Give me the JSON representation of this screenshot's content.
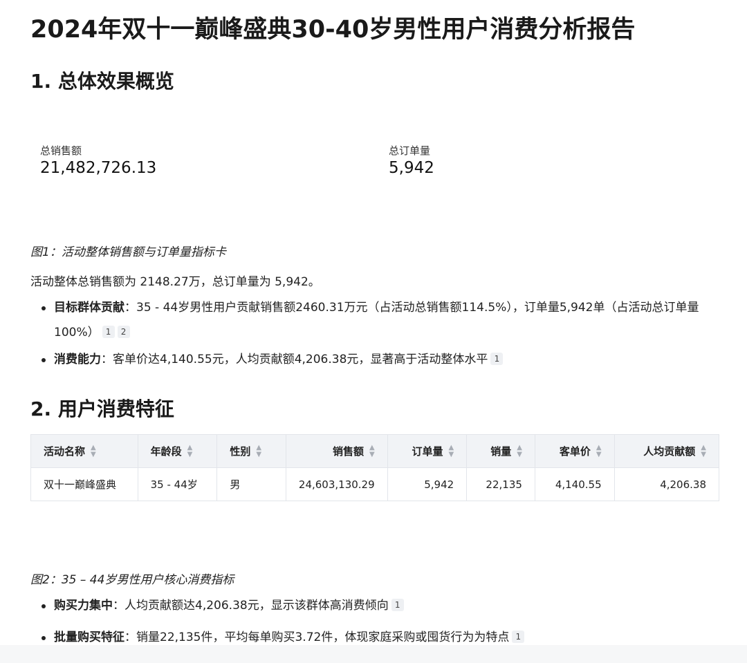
{
  "report": {
    "title": "2024年双十一巅峰盛典30-40岁男性用户消费分析报告"
  },
  "section1": {
    "title": "1. 总体效果概览",
    "kpis": [
      {
        "label": "总销售额",
        "value": "21,482,726.13"
      },
      {
        "label": "总订单量",
        "value": "5,942"
      }
    ],
    "caption": "图1：活动整体销售额与订单量指标卡",
    "summary": "活动整体总销售额为 2148.27万，总订单量为 5,942。",
    "bullets": [
      {
        "label": "目标群体贡献",
        "text": "：35 - 44岁男性用户贡献销售额2460.31万元（占活动总销售额114.5%），订单量5,942单（占活动总订单量100%）",
        "refs": [
          "1",
          "2"
        ]
      },
      {
        "label": "消费能力",
        "text": "：客单价达4,140.55元，人均贡献额4,206.38元，显著高于活动整体水平",
        "refs": [
          "1"
        ]
      }
    ]
  },
  "section2": {
    "title": "2. 用户消费特征",
    "table": {
      "headers": [
        "活动名称",
        "年龄段",
        "性别",
        "销售额",
        "订单量",
        "销量",
        "客单价",
        "人均贡献额"
      ],
      "rows": [
        [
          "双十一巅峰盛典",
          "35 - 44岁",
          "男",
          "24,603,130.29",
          "5,942",
          "22,135",
          "4,140.55",
          "4,206.38"
        ]
      ]
    },
    "caption": "图2：35 – 44岁男性用户核心消费指标",
    "bullets": [
      {
        "label": "购买力集中",
        "text": "：人均贡献额达4,206.38元，显示该群体高消费倾向",
        "refs": [
          "1"
        ]
      },
      {
        "label": "批量购买特征",
        "text": "：销量22,135件，平均每单购买3.72件，体现家庭采购或囤货行为为特点",
        "refs": [
          "1"
        ]
      }
    ]
  },
  "icons": {
    "sort": "sort-icon"
  }
}
